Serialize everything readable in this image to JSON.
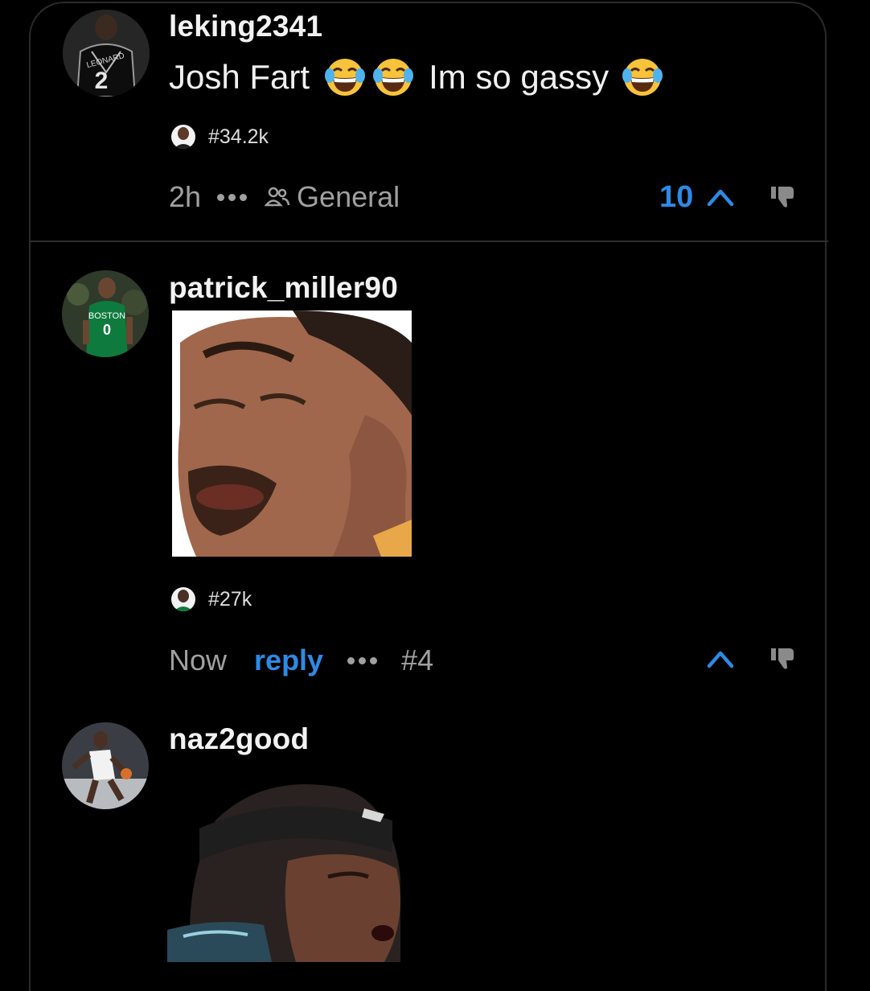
{
  "comments": [
    {
      "username": "leking2341",
      "text_part1": "Josh Fart",
      "text_part2": "Im so gassy",
      "emoji_name": "face-with-tears-of-joy",
      "badge": "#34.2k",
      "time": "2h",
      "channel": "General",
      "votes": "10",
      "jersey_text": "LEONARD",
      "jersey_number": "2"
    },
    {
      "username": "patrick_miller90",
      "badge": "#27k",
      "time": "Now",
      "reply_label": "reply",
      "rank": "#4",
      "jersey_text": "BOSTON",
      "jersey_number": "0"
    },
    {
      "username": "naz2good"
    }
  ],
  "colors": {
    "accent": "#2d8ae6",
    "background": "#000000",
    "muted": "#a0a0a0"
  },
  "icons": [
    "more-dots-icon",
    "group-icon",
    "upvote-chevron-icon",
    "downvote-thumb-icon"
  ]
}
